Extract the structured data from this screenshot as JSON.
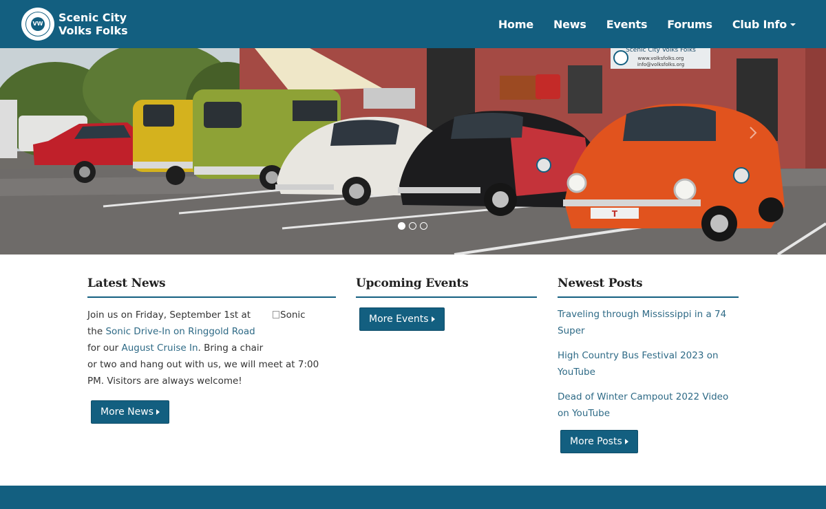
{
  "brand": {
    "line1": "Scenic City",
    "line2": "Volks Folks",
    "logo_text": "VW",
    "logo_icon": "vw-club-logo-icon"
  },
  "nav": {
    "items": [
      "Home",
      "News",
      "Events",
      "Forums",
      "Club Info"
    ]
  },
  "hero": {
    "banner_line1": "Scenic City Volks Folks",
    "banner_line2": "www.volksfolks.org",
    "banner_line3": "info@volksfolks.org",
    "plate": "T"
  },
  "latest_news": {
    "title": "Latest News",
    "text1": "Join us on Friday, September 1st at the ",
    "link1": "Sonic Drive-In on Ringgold Road",
    "text2": " for our ",
    "link2": "August Cruise In",
    "text3": ". Bring a chair or two and hang out with us, we will meet at 7:00 PM. Visitors are always welcome!",
    "image_alt": "Sonic",
    "button": "More News"
  },
  "upcoming_events": {
    "title": "Upcoming Events",
    "button": "More Events"
  },
  "newest_posts": {
    "title": "Newest Posts",
    "items": [
      "Traveling through Mississippi in a 74 Super",
      "High Country Bus Festival 2023 on YouTube",
      "Dead of Winter Campout 2022 Video on YouTube"
    ],
    "button": "More Posts"
  },
  "colors": {
    "primary": "#135f80",
    "link": "#2e6a86"
  }
}
